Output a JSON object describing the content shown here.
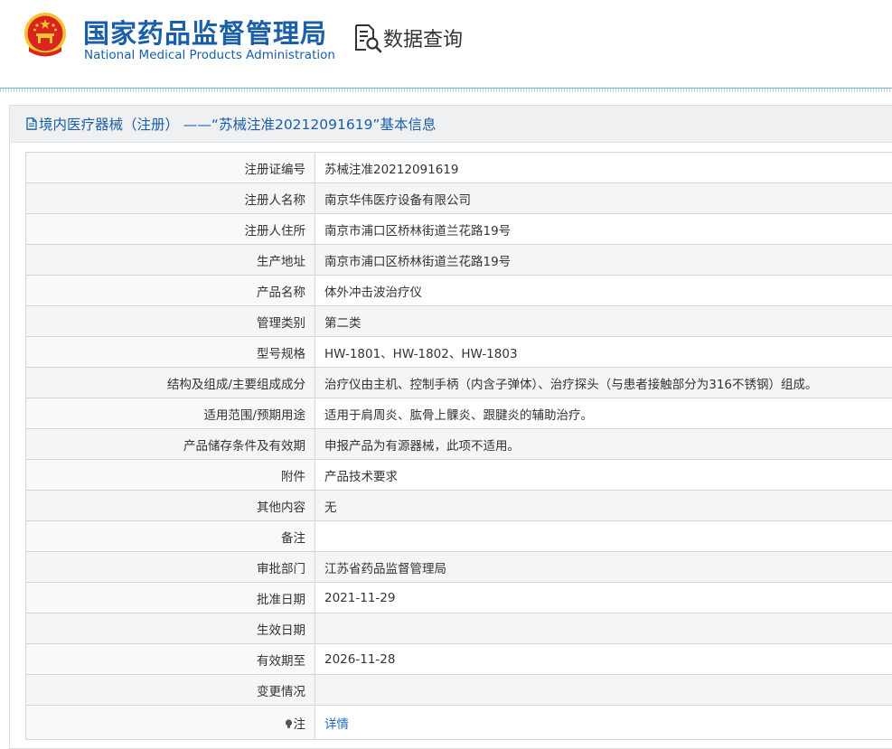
{
  "header": {
    "org_name_cn": "国家药品监督管理局",
    "org_name_en": "National Medical Products Administration",
    "search_label": "数据查询"
  },
  "panel": {
    "title": "境内医疗器械（注册） ——“苏械注准20212091619”基本信息"
  },
  "fields": [
    {
      "label": "注册证编号",
      "value": "苏械注准20212091619"
    },
    {
      "label": "注册人名称",
      "value": "南京华伟医疗设备有限公司"
    },
    {
      "label": "注册人住所",
      "value": "南京市浦口区桥林街道兰花路19号"
    },
    {
      "label": "生产地址",
      "value": "南京市浦口区桥林街道兰花路19号"
    },
    {
      "label": "产品名称",
      "value": "体外冲击波治疗仪"
    },
    {
      "label": "管理类别",
      "value": "第二类"
    },
    {
      "label": "型号规格",
      "value": "HW-1801、HW-1802、HW-1803"
    },
    {
      "label": "结构及组成/主要组成成分",
      "value": "治疗仪由主机、控制手柄（内含子弹体）、治疗探头（与患者接触部分为316不锈钢）组成。"
    },
    {
      "label": "适用范围/预期用途",
      "value": "适用于肩周炎、肱骨上髁炎、跟腱炎的辅助治疗。"
    },
    {
      "label": "产品储存条件及有效期",
      "value": "申报产品为有源器械，此项不适用。"
    },
    {
      "label": "附件",
      "value": "产品技术要求"
    },
    {
      "label": "其他内容",
      "value": "无"
    },
    {
      "label": "备注",
      "value": ""
    },
    {
      "label": "审批部门",
      "value": "江苏省药品监督管理局"
    },
    {
      "label": "批准日期",
      "value": "2021-11-29"
    },
    {
      "label": "生效日期",
      "value": ""
    },
    {
      "label": "有效期至",
      "value": "2026-11-28"
    },
    {
      "label": "变更情况",
      "value": ""
    }
  ],
  "note": {
    "label": "注",
    "link_text": "详情"
  },
  "colors": {
    "brand_blue": "#1b5fa8",
    "emblem_red": "#d7261e",
    "emblem_gold": "#f4c430"
  }
}
